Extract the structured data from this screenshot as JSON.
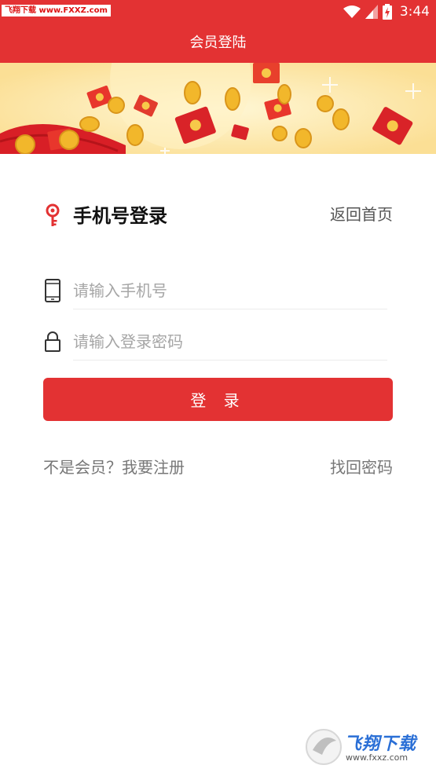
{
  "status_bar": {
    "watermark": "飞翔下载 www.FXXZ.com",
    "time": "3:44",
    "icons": [
      "wifi-icon",
      "signal-icon",
      "battery-icon"
    ]
  },
  "header": {
    "title": "会员登陆"
  },
  "banner": {
    "description_icons": [
      "red-envelope-icon",
      "gold-coin-icon"
    ]
  },
  "login": {
    "title": "手机号登录",
    "back_home": "返回首页",
    "phone_placeholder": "请输入手机号",
    "password_placeholder": "请输入登录密码",
    "submit_label": "登 录",
    "register_link": "不是会员？我要注册",
    "forgot_link": "找回密码"
  },
  "watermark_bottom": {
    "brand": "飞翔下载",
    "url": "www.fxxz.com"
  },
  "colors": {
    "primary": "#e33233",
    "banner_bg": "#fdebb6",
    "placeholder": "#a6a6a6",
    "link_gray": "#777777"
  }
}
